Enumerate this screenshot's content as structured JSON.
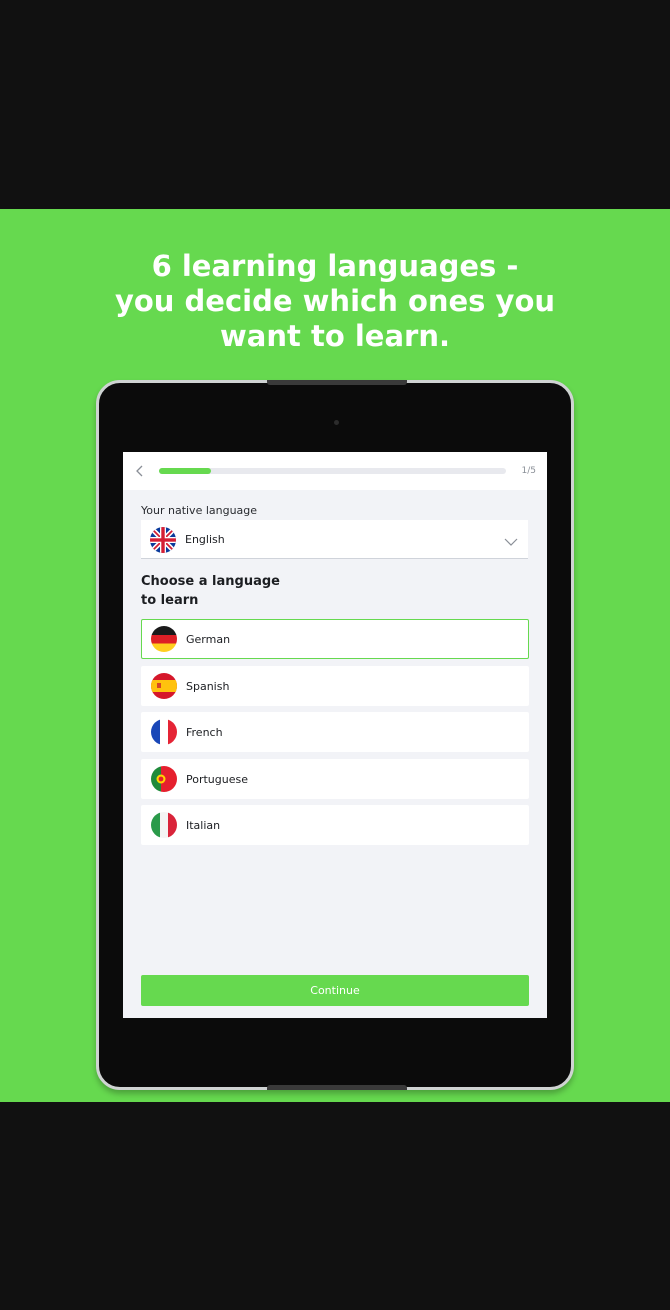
{
  "headline": "6 learning languages -\nyou decide which ones you\nwant to learn.",
  "colors": {
    "brand_green": "#66d94f",
    "page_bg": "#111111",
    "screen_bg": "#f2f3f7"
  },
  "progress": {
    "step_text": "1/5",
    "fraction": 0.15
  },
  "native": {
    "label": "Your native language",
    "value": "English",
    "flag_icon": "uk-flag-icon"
  },
  "learn": {
    "title": "Choose a language\nto learn",
    "languages": [
      {
        "label": "German",
        "flag_icon": "germany-flag-icon",
        "selected": true
      },
      {
        "label": "Spanish",
        "flag_icon": "spain-flag-icon",
        "selected": false
      },
      {
        "label": "French",
        "flag_icon": "france-flag-icon",
        "selected": false
      },
      {
        "label": "Portuguese",
        "flag_icon": "portugal-flag-icon",
        "selected": false
      },
      {
        "label": "Italian",
        "flag_icon": "italy-flag-icon",
        "selected": false
      }
    ]
  },
  "continue_label": "Continue"
}
